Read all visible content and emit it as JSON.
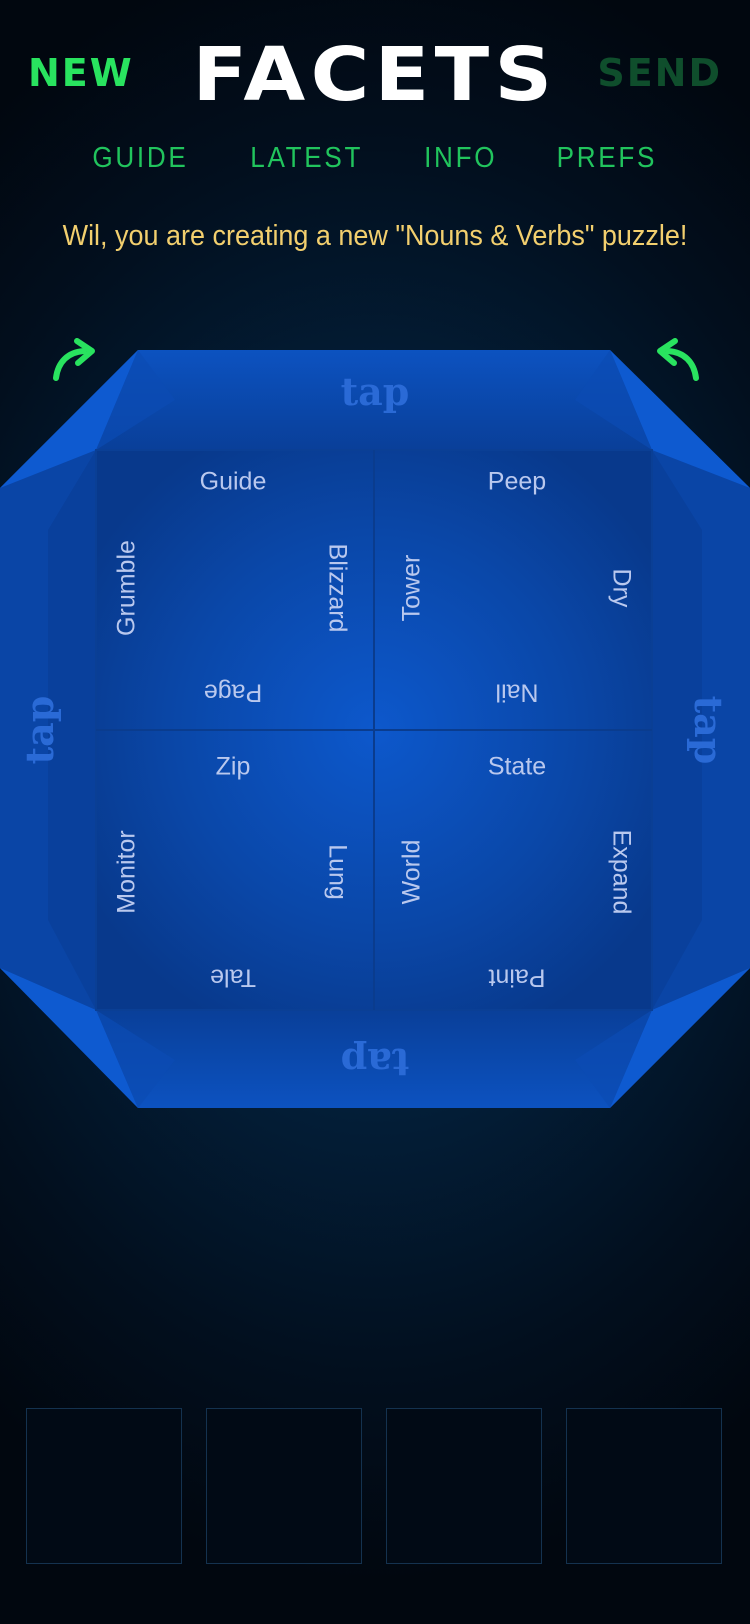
{
  "header": {
    "new_label": "NEW",
    "title": "FACETS",
    "send_label": "SEND"
  },
  "nav": [
    "GUIDE",
    "LATEST",
    "INFO",
    "PREFS"
  ],
  "message": "Wil, you are creating a new \"Nouns & Verbs\" puzzle!",
  "tap_label": "tap",
  "facets": [
    {
      "top": "Guide",
      "left": "Grumble",
      "right": "Blizzard",
      "bottom": "Page"
    },
    {
      "top": "Peep",
      "left": "Tower",
      "right": "Dry",
      "bottom": "Nail"
    },
    {
      "top": "Zip",
      "left": "Monitor",
      "right": "Lung",
      "bottom": "Tale"
    },
    {
      "top": "State",
      "left": "World",
      "right": "Expand",
      "bottom": "Paint"
    }
  ],
  "answer_slots": [
    "",
    "",
    "",
    ""
  ],
  "colors": {
    "accent_green": "#29e35f",
    "send_green": "#0f4e2c",
    "message_yellow": "#f2cf6e",
    "gem_blue": "#0b4fb8",
    "tap_blue": "#2a6ad6"
  },
  "icons": {
    "rotate_left": "rotate-left-arrow-icon",
    "rotate_right": "rotate-right-arrow-icon"
  }
}
